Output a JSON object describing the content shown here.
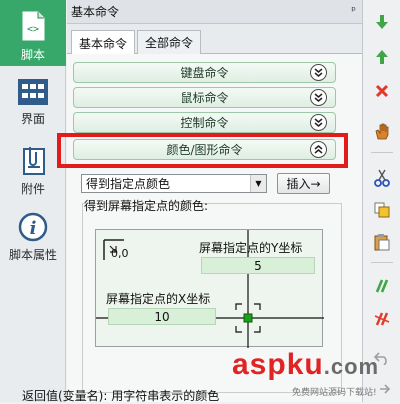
{
  "sidebar": {
    "items": [
      {
        "label": "脚本",
        "icon": "script-icon",
        "active": true
      },
      {
        "label": "界面",
        "icon": "grid-icon"
      },
      {
        "label": "附件",
        "icon": "clip-icon"
      },
      {
        "label": "脚本属性",
        "icon": "info-icon"
      }
    ]
  },
  "panel": {
    "title": "基本命令",
    "pin": "ᵖ"
  },
  "tabs": [
    {
      "label": "基本命令",
      "active": true
    },
    {
      "label": "全部命令"
    }
  ],
  "categories": [
    {
      "label": "键盘命令"
    },
    {
      "label": "鼠标命令"
    },
    {
      "label": "控制命令"
    },
    {
      "label": "颜色/图形命令",
      "expanded": true
    }
  ],
  "command": {
    "dropdown_value": "得到指定点颜色",
    "insert_label": "插入→",
    "group_label": "得到屏幕指定点的颜色:",
    "y_label": "屏幕指定点的Y坐标",
    "y_value": "5",
    "x_label": "屏幕指定点的X坐标",
    "x_value": "10",
    "origin_label": "0,0",
    "return_label": "返回值(变量名): 用字符串表示的颜色"
  },
  "watermark": {
    "main_red": "asp",
    "main_gray": "ku",
    "suffix": ".com",
    "sub": "免费网站源码下载站!"
  },
  "colors": {
    "accent": "#37a86a",
    "highlight": "#e21b1b"
  }
}
